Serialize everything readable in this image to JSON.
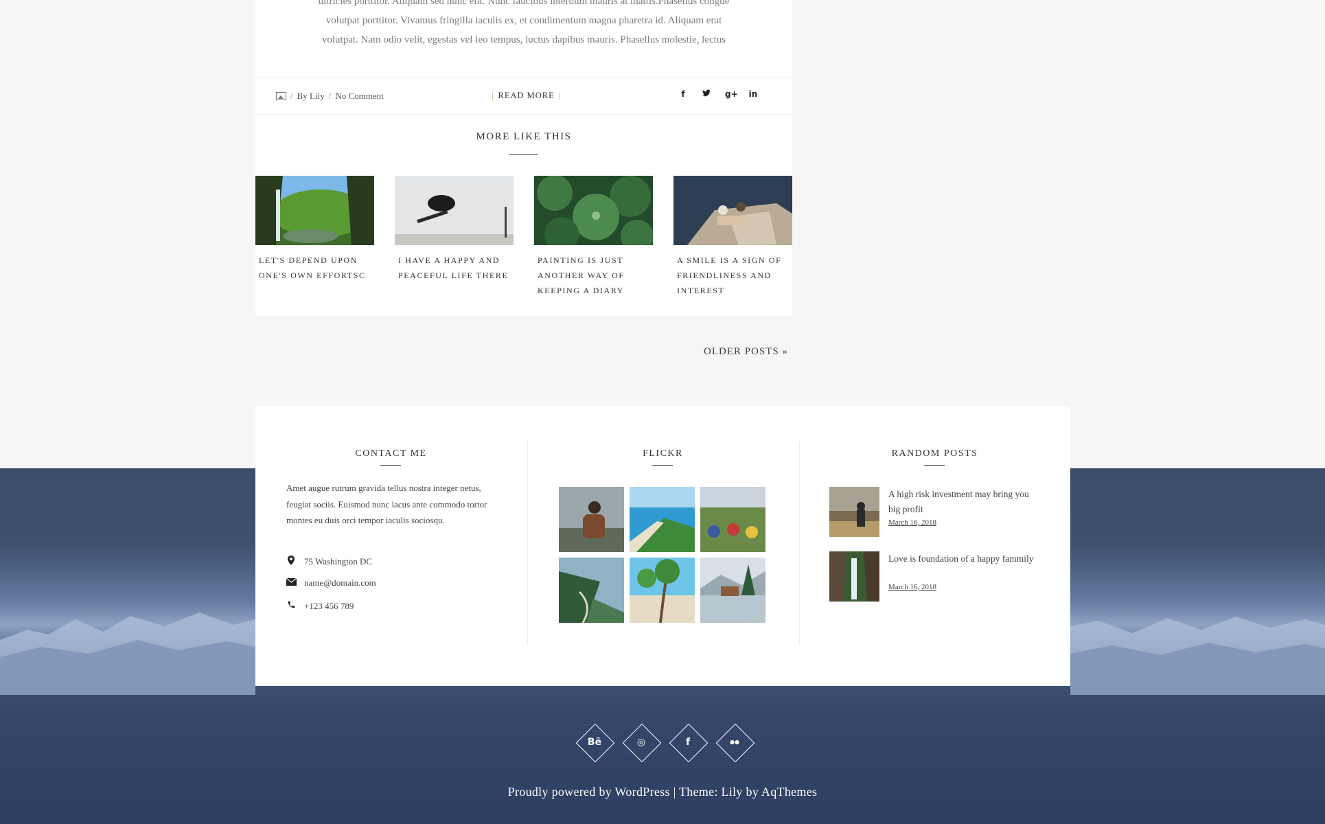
{
  "post": {
    "excerpt_lines": [
      "ultricies porttitor. Aliquam sed nunc elit. Nunc faucibus interdum mauris at mattis.Phasellus congue",
      "volutpat porttitor. Vivamus fringilla iaculis ex, et condimentum magna pharetra id. Aliquam erat",
      "volutpat. Nam odio velit, egestas vel leo tempus, luctus dapibus mauris. Phasellus molestie, lectus"
    ],
    "meta": {
      "author": "By Lily",
      "comments": "No Comment",
      "separator": "/"
    },
    "read_more": "READ MORE",
    "read_more_bar": "|",
    "share_icons": [
      "facebook-icon",
      "twitter-icon",
      "google-plus-icon",
      "linkedin-icon"
    ],
    "share_glyphs": [
      "f",
      "t",
      "g+",
      "in"
    ]
  },
  "more_like_this": {
    "title": "MORE LIKE THIS",
    "items": [
      {
        "title": "LET'S DEPEND UPON ONE'S OWN EFFORTSC"
      },
      {
        "title": "I HAVE A HAPPY AND PEACEFUL LIFE THERE"
      },
      {
        "title": "PAINTING IS JUST ANOTHER WAY OF KEEPING A DIARY"
      },
      {
        "title": "A SMILE IS A SIGN OF FRIENDLINESS AND INTEREST"
      }
    ]
  },
  "pagination": {
    "older": "OLDER POSTS »"
  },
  "widgets": {
    "contact": {
      "title": "CONTACT ME",
      "text": "Amet augue rutrum gravida tellus nostra integer netus, feugiat sociis. Euismod nunc lacus ante commodo tortor montes eu duis orci tempor iaculis sociosqu.",
      "address": "75 Washington DC",
      "email": "name@domain.com",
      "phone": "+123 456 789"
    },
    "flickr": {
      "title": "FLICKR"
    },
    "random_posts": {
      "title": "RANDOM POSTS",
      "items": [
        {
          "title": "A high risk investment may bring you big profit",
          "date": "March 16, 2018"
        },
        {
          "title": "Love is foundation of a happy fammily",
          "date": "March 16, 2018"
        }
      ]
    }
  },
  "footer": {
    "social": [
      {
        "name": "behance-icon",
        "glyph": "Bē"
      },
      {
        "name": "dribbble-icon",
        "glyph": "◎"
      },
      {
        "name": "facebook-icon",
        "glyph": "f"
      },
      {
        "name": "flickr-icon",
        "glyph": "●●"
      }
    ],
    "credit": "Proudly powered by WordPress | Theme: Lily by AqThemes"
  }
}
